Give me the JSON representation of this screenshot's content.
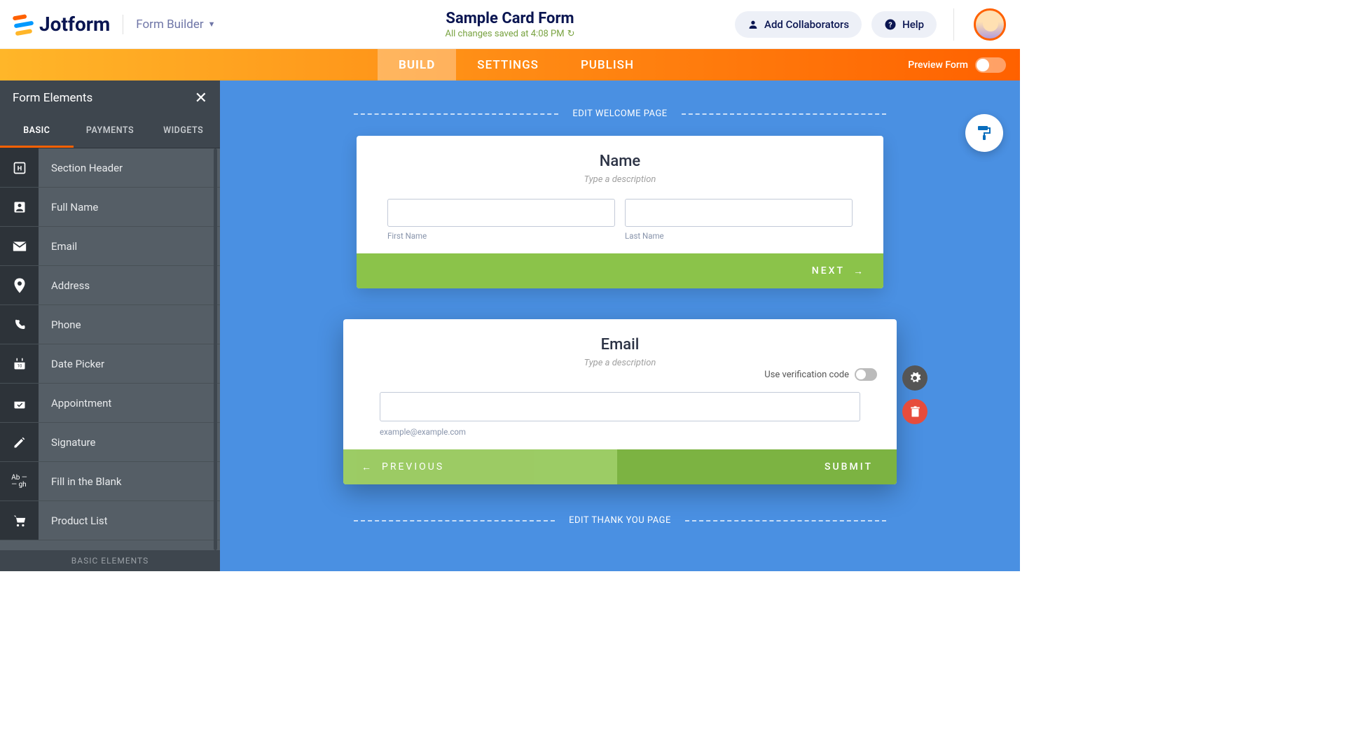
{
  "header": {
    "logo_text": "Jotform",
    "form_builder_label": "Form Builder",
    "title": "Sample Card Form",
    "saved_text": "All changes saved at 4:08 PM",
    "collaborators_label": "Add Collaborators",
    "help_label": "Help"
  },
  "orange_tabs": {
    "build": "BUILD",
    "settings": "SETTINGS",
    "publish": "PUBLISH",
    "preview_label": "Preview Form"
  },
  "sidebar": {
    "title": "Form Elements",
    "tabs": {
      "basic": "BASIC",
      "payments": "PAYMENTS",
      "widgets": "WIDGETS"
    },
    "items": [
      {
        "label": "Section Header"
      },
      {
        "label": "Full Name"
      },
      {
        "label": "Email"
      },
      {
        "label": "Address"
      },
      {
        "label": "Phone"
      },
      {
        "label": "Date Picker"
      },
      {
        "label": "Appointment"
      },
      {
        "label": "Signature"
      },
      {
        "label": "Fill in the Blank"
      },
      {
        "label": "Product List"
      }
    ],
    "footer": "BASIC ELEMENTS"
  },
  "canvas": {
    "welcome_label": "EDIT WELCOME PAGE",
    "thankyou_label": "EDIT THANK YOU PAGE",
    "card_name": {
      "title": "Name",
      "desc": "Type a description",
      "first_label": "First Name",
      "last_label": "Last Name",
      "next": "NEXT"
    },
    "card_email": {
      "title": "Email",
      "desc": "Type a description",
      "verify_label": "Use verification code",
      "placeholder": "example@example.com",
      "previous": "PREVIOUS",
      "submit": "SUBMIT"
    }
  }
}
